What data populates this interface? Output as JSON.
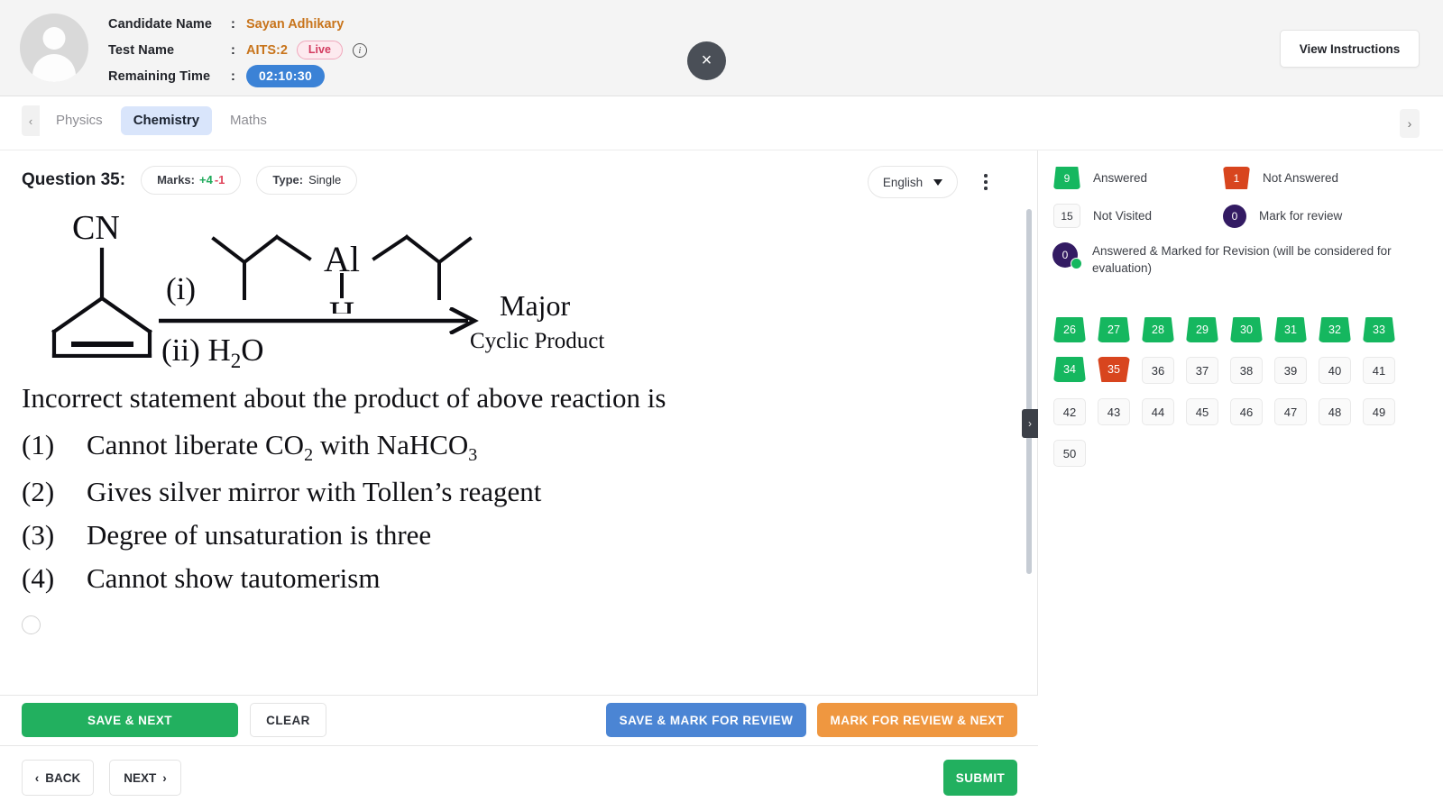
{
  "header": {
    "candidate_label": "Candidate Name",
    "candidate_value": "Sayan Adhikary",
    "test_label": "Test Name",
    "test_value": "AITS:2",
    "live_badge": "Live",
    "time_label": "Remaining Time",
    "time_value": "02:10:30",
    "colon": ":",
    "close_glyph": "×",
    "view_instructions": "View Instructions",
    "info_glyph": "i"
  },
  "tabs": {
    "scroll_left_glyph": "‹",
    "scroll_right_glyph": "›",
    "items": [
      {
        "label": "Physics",
        "active": false
      },
      {
        "label": "Chemistry",
        "active": true
      },
      {
        "label": "Maths",
        "active": false
      }
    ]
  },
  "question": {
    "title": "Question 35:",
    "marks_label": "Marks:",
    "marks_positive": "+4",
    "marks_negative": "-1",
    "type_label": "Type:",
    "type_value": "Single",
    "language": "English",
    "scheme": {
      "reactant_substituent": "CN",
      "condition_i": "(i)",
      "condition_ii_prefix": "(ii) H",
      "condition_ii_sub": "2",
      "condition_ii_suffix": "O",
      "reagent_atom": "Al",
      "reagent_hydride": "H",
      "product_major": "Major",
      "product_cyclic": "Cyclic Product"
    },
    "text": "Incorrect statement about the product of above reaction is",
    "options": [
      {
        "num": "(1)",
        "text_a": "Cannot liberate CO",
        "sub": "2",
        "text_b": " with NaHCO",
        "sub2": "3",
        "text_c": ""
      },
      {
        "num": "(2)",
        "text_a": "Gives silver mirror with Tollen’s reagent",
        "sub": "",
        "text_b": "",
        "sub2": "",
        "text_c": ""
      },
      {
        "num": "(3)",
        "text_a": "Degree of unsaturation is three",
        "sub": "",
        "text_b": "",
        "sub2": "",
        "text_c": ""
      },
      {
        "num": "(4)",
        "text_a": "Cannot show tautomerism",
        "sub": "",
        "text_b": "",
        "sub2": "",
        "text_c": ""
      }
    ],
    "collapse_glyph": "›"
  },
  "actions": {
    "save_next": "SAVE & NEXT",
    "clear": "CLEAR",
    "save_mark_review": "SAVE & MARK FOR REVIEW",
    "mark_review_next": "MARK FOR REVIEW & NEXT"
  },
  "nav": {
    "back": "BACK",
    "next": "NEXT",
    "back_glyph": "‹",
    "next_glyph": "›",
    "submit": "SUBMIT"
  },
  "legend": [
    {
      "count": "9",
      "label": "Answered",
      "style": "answered"
    },
    {
      "count": "1",
      "label": "Not Answered",
      "style": "not-answered"
    },
    {
      "count": "15",
      "label": "Not Visited",
      "style": "not-visited"
    },
    {
      "count": "0",
      "label": "Mark for review",
      "style": "review"
    },
    {
      "count": "0",
      "label": "Answered & Marked for Revision (will be considered for evaluation)",
      "style": "answered-review"
    }
  ],
  "question_grid": [
    {
      "n": "26",
      "state": "answered"
    },
    {
      "n": "27",
      "state": "answered"
    },
    {
      "n": "28",
      "state": "answered"
    },
    {
      "n": "29",
      "state": "answered"
    },
    {
      "n": "30",
      "state": "answered"
    },
    {
      "n": "31",
      "state": "answered"
    },
    {
      "n": "32",
      "state": "answered"
    },
    {
      "n": "33",
      "state": "answered"
    },
    {
      "n": "34",
      "state": "answered"
    },
    {
      "n": "35",
      "state": "not-answered"
    },
    {
      "n": "36",
      "state": "not-visited"
    },
    {
      "n": "37",
      "state": "not-visited"
    },
    {
      "n": "38",
      "state": "not-visited"
    },
    {
      "n": "39",
      "state": "not-visited"
    },
    {
      "n": "40",
      "state": "not-visited"
    },
    {
      "n": "41",
      "state": "not-visited"
    },
    {
      "n": "42",
      "state": "not-visited"
    },
    {
      "n": "43",
      "state": "not-visited"
    },
    {
      "n": "44",
      "state": "not-visited"
    },
    {
      "n": "45",
      "state": "not-visited"
    },
    {
      "n": "46",
      "state": "not-visited"
    },
    {
      "n": "47",
      "state": "not-visited"
    },
    {
      "n": "48",
      "state": "not-visited"
    },
    {
      "n": "49",
      "state": "not-visited"
    },
    {
      "n": "50",
      "state": "not-visited"
    }
  ],
  "colors": {
    "answered": "#15b75f",
    "not_answered": "#d8451e",
    "review": "#331b63",
    "active_tab": "#d9e5fb",
    "time_badge": "#3b82d6",
    "save_next": "#22b05f",
    "save_mark": "#4b85d4",
    "mark_next": "#ef9740",
    "candidate_value": "#c8741b"
  }
}
